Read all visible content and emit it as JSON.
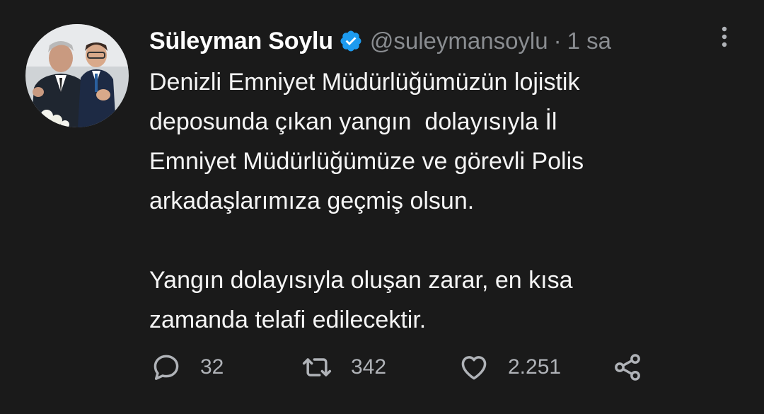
{
  "author": {
    "display_name": "Süleyman Soylu",
    "handle": "@suleymansoylu",
    "separator": "·",
    "time": "1 sa",
    "verified": true,
    "avatar_icon": "profile-photo"
  },
  "tweet": {
    "paragraphs": [
      "Denizli Emniyet Müdürlüğümüzün lojistik\ndeposunda çıkan yangın  dolayısıyla İl\nEmniyet Müdürlüğümüze ve görevli Polis\narkadaşlarımıza geçmiş olsun.",
      "Yangın dolayısıyla oluşan zarar, en kısa\nzamanda telafi edilecektir."
    ]
  },
  "actions": {
    "reply_count": "32",
    "retweet_count": "342",
    "like_count": "2.251",
    "reply_icon": "reply-icon",
    "retweet_icon": "retweet-icon",
    "like_icon": "heart-icon",
    "share_icon": "share-icon"
  },
  "colors": {
    "background": "#1a1a1a",
    "text": "#ffffff",
    "secondary_text": "#8a8d91",
    "verified_blue": "#1d9bf0"
  }
}
